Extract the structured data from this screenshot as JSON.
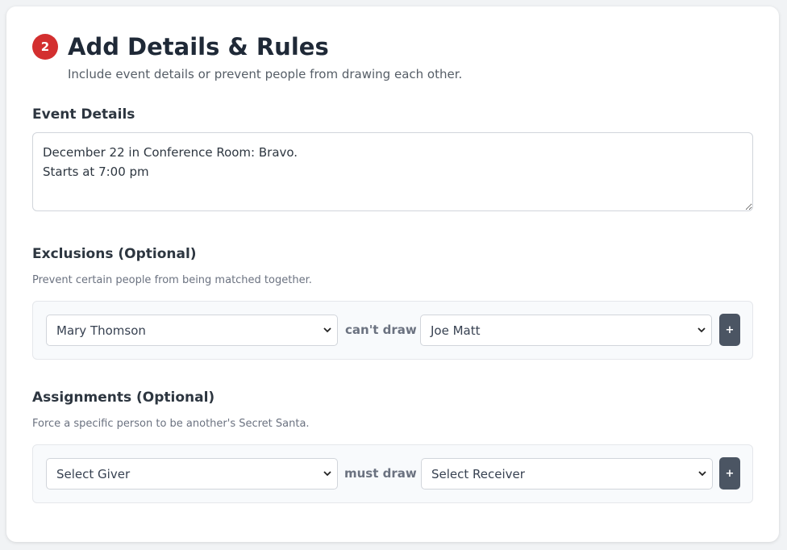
{
  "step": {
    "number": "2",
    "title": "Add Details & Rules",
    "subtitle": "Include event details or prevent people from drawing each other."
  },
  "event_details": {
    "label": "Event Details",
    "value": "December 22 in Conference Room: Bravo.\nStarts at 7:00 pm"
  },
  "exclusions": {
    "label": "Exclusions (Optional)",
    "description": "Prevent certain people from being matched together.",
    "giver": "Mary Thomson",
    "connector": "can't draw",
    "receiver": "Joe Matt",
    "add_label": "+"
  },
  "assignments": {
    "label": "Assignments (Optional)",
    "description": "Force a specific person to be another's Secret Santa.",
    "giver": "Select Giver",
    "connector": "must draw",
    "receiver": "Select Receiver",
    "add_label": "+"
  },
  "colors": {
    "badge": "#d32f2f",
    "add_button": "#4b5563"
  }
}
